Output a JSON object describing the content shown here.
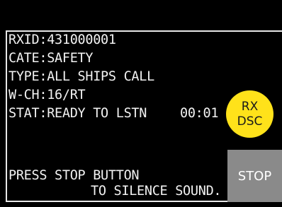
{
  "call": {
    "rxid": "RXID:431000001",
    "category": "CATE:SAFETY",
    "type": "TYPE:ALL SHIPS CALL",
    "work_channel": "W-CH:16/RT",
    "status": "STAT:READY TO LSTN",
    "timer": "00:01"
  },
  "badge": {
    "line1": "RX",
    "line2": "DSC",
    "color": "#ffe21a"
  },
  "message": {
    "line1": "PRESS STOP BUTTON",
    "line2": "TO SILENCE SOUND."
  },
  "controls": {
    "stop_label": "STOP"
  }
}
